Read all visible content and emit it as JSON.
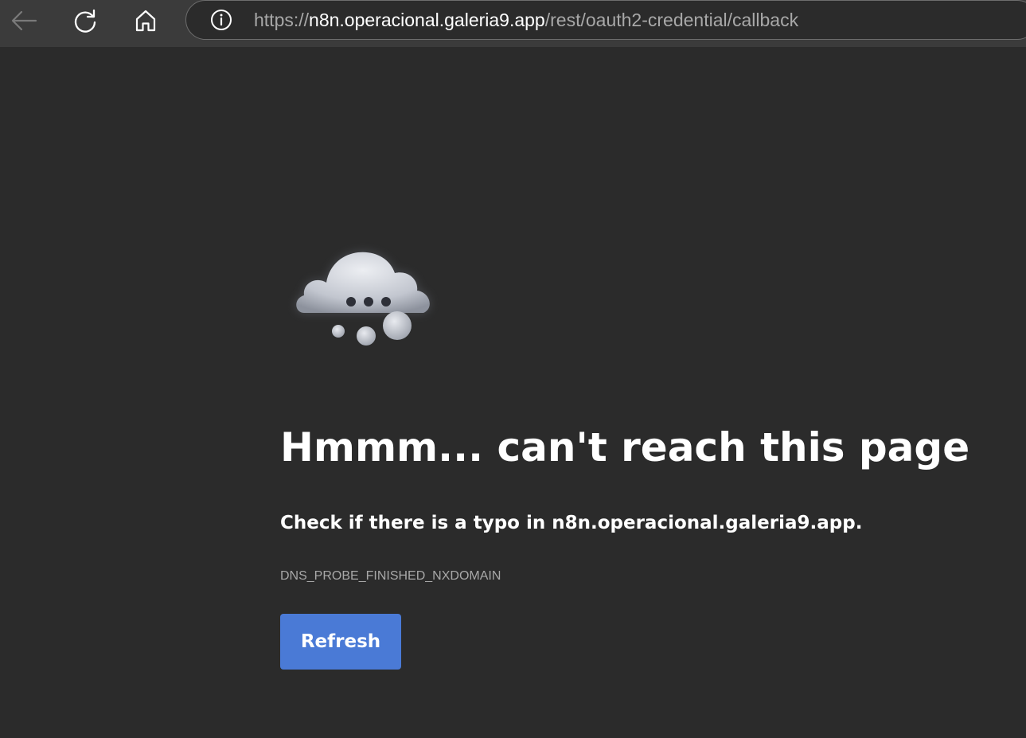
{
  "browser": {
    "url_scheme": "https://",
    "url_host": "n8n.operacional.galeria9.app",
    "url_path": "/rest/oauth2-credential/callback",
    "icons": {
      "back": "back-arrow-icon",
      "refresh": "refresh-icon",
      "home": "home-icon",
      "site_info": "info-icon"
    }
  },
  "error_page": {
    "illustration": "cloud-thinking-icon",
    "heading": "Hmmm... can't reach this page",
    "subtext": "Check if there is a typo in n8n.operacional.galeria9.app.",
    "error_code": "DNS_PROBE_FINISHED_NXDOMAIN",
    "refresh_label": "Refresh"
  },
  "colors": {
    "page_background": "#2b2b2b",
    "toolbar_background": "#3b3b3b",
    "accent_button": "#4a7ad6",
    "muted_text": "#a8a8a8"
  }
}
